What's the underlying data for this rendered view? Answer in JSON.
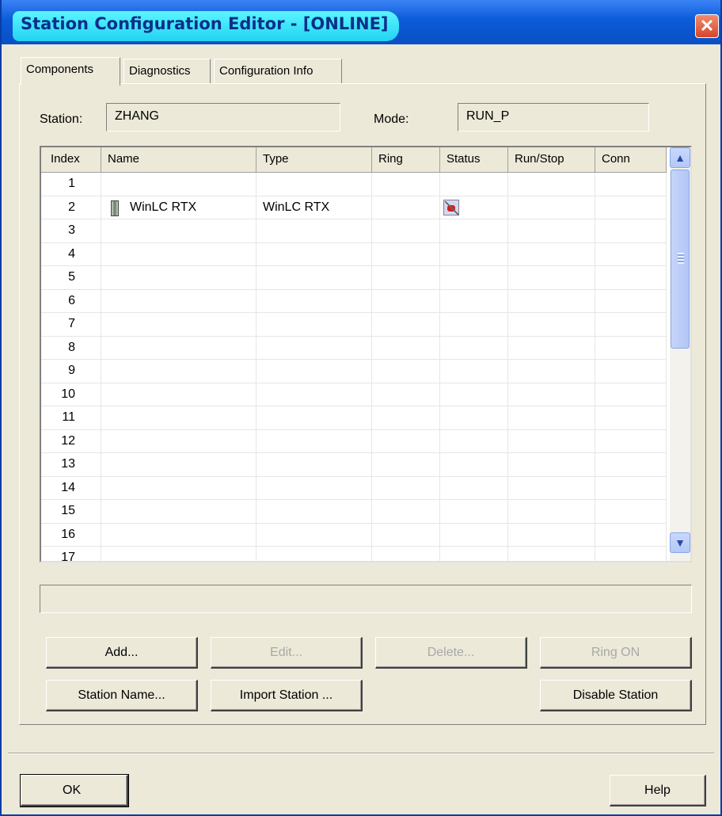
{
  "window": {
    "title": "Station Configuration Editor - [ONLINE]",
    "close_glyph": "✕"
  },
  "tabs": [
    {
      "label": "Components",
      "active": true
    },
    {
      "label": "Diagnostics",
      "active": false
    },
    {
      "label": "Configuration Info",
      "active": false
    }
  ],
  "station": {
    "label": "Station:",
    "value": "ZHANG"
  },
  "mode": {
    "label": "Mode:",
    "value": "RUN_P"
  },
  "table": {
    "columns": [
      "Index",
      "Name",
      "Type",
      "Ring",
      "Status",
      "Run/Stop",
      "Conn"
    ],
    "rows": [
      {
        "index": "1",
        "name": "",
        "type": "",
        "icon": ""
      },
      {
        "index": "2",
        "name": "WinLC RTX",
        "type": "WinLC RTX",
        "icon": "pc-station-icon",
        "status_icon": "status-fault-icon"
      },
      {
        "index": "3"
      },
      {
        "index": "4"
      },
      {
        "index": "5"
      },
      {
        "index": "6"
      },
      {
        "index": "7"
      },
      {
        "index": "8"
      },
      {
        "index": "9"
      },
      {
        "index": "10"
      },
      {
        "index": "11"
      },
      {
        "index": "12"
      },
      {
        "index": "13"
      },
      {
        "index": "14"
      },
      {
        "index": "15"
      },
      {
        "index": "16"
      },
      {
        "index": "17"
      }
    ]
  },
  "buttons": {
    "add": "Add...",
    "edit": "Edit...",
    "delete": "Delete...",
    "ring_on": "Ring ON",
    "station_name": "Station Name...",
    "import_station": "Import Station ...",
    "disable_station": "Disable Station",
    "ok": "OK",
    "help": "Help"
  },
  "colors": {
    "title_bar": "#0b5bd8",
    "title_highlight": "#22d3f2",
    "dialog_bg": "#ece9d8",
    "close_button": "#d8452b"
  }
}
